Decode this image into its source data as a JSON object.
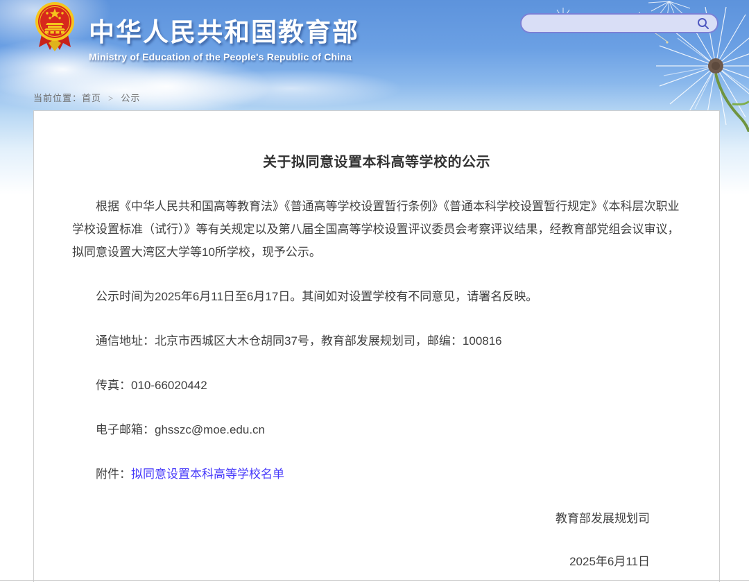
{
  "header": {
    "site_title": "中华人民共和国教育部",
    "site_subtitle": "Ministry of Education of the People's Republic of China",
    "emblem": "national-emblem-of-china",
    "search": {
      "value": "",
      "placeholder": ""
    }
  },
  "breadcrumb": {
    "label": "当前位置：",
    "home": "首页",
    "separator": ">",
    "current": "公示"
  },
  "article": {
    "title": "关于拟同意设置本科高等学校的公示",
    "paragraphs": [
      "根据《中华人民共和国高等教育法》《普通高等学校设置暂行条例》《普通本科学校设置暂行规定》《本科层次职业学校设置标准（试行）》等有关规定以及第八届全国高等学校设置评议委员会考察评议结果，经教育部党组会议审议，拟同意设置大湾区大学等10所学校，现予公示。",
      "公示时间为2025年6月11日至6月17日。其间如对设置学校有不同意见，请署名反映。",
      "通信地址：北京市西城区大木仓胡同37号，教育部发展规划司，邮编：100816",
      "传真：010-66020442",
      "电子邮箱：ghsszc@moe.edu.cn"
    ],
    "attachment": {
      "label": "附件：",
      "link_text": "拟同意设置本科高等学校名单"
    },
    "signature": "教育部发展规划司",
    "date": "2025年6月11日"
  },
  "colors": {
    "sky_top": "#5d93dc",
    "search_border": "#7a80d6",
    "search_fill": "#d9def6",
    "body_text": "#404040",
    "title_text": "#333333",
    "link": "#4639fa",
    "card_border": "#cfcfcf",
    "emblem_red": "#d7281c",
    "emblem_gold": "#f5c51d"
  }
}
